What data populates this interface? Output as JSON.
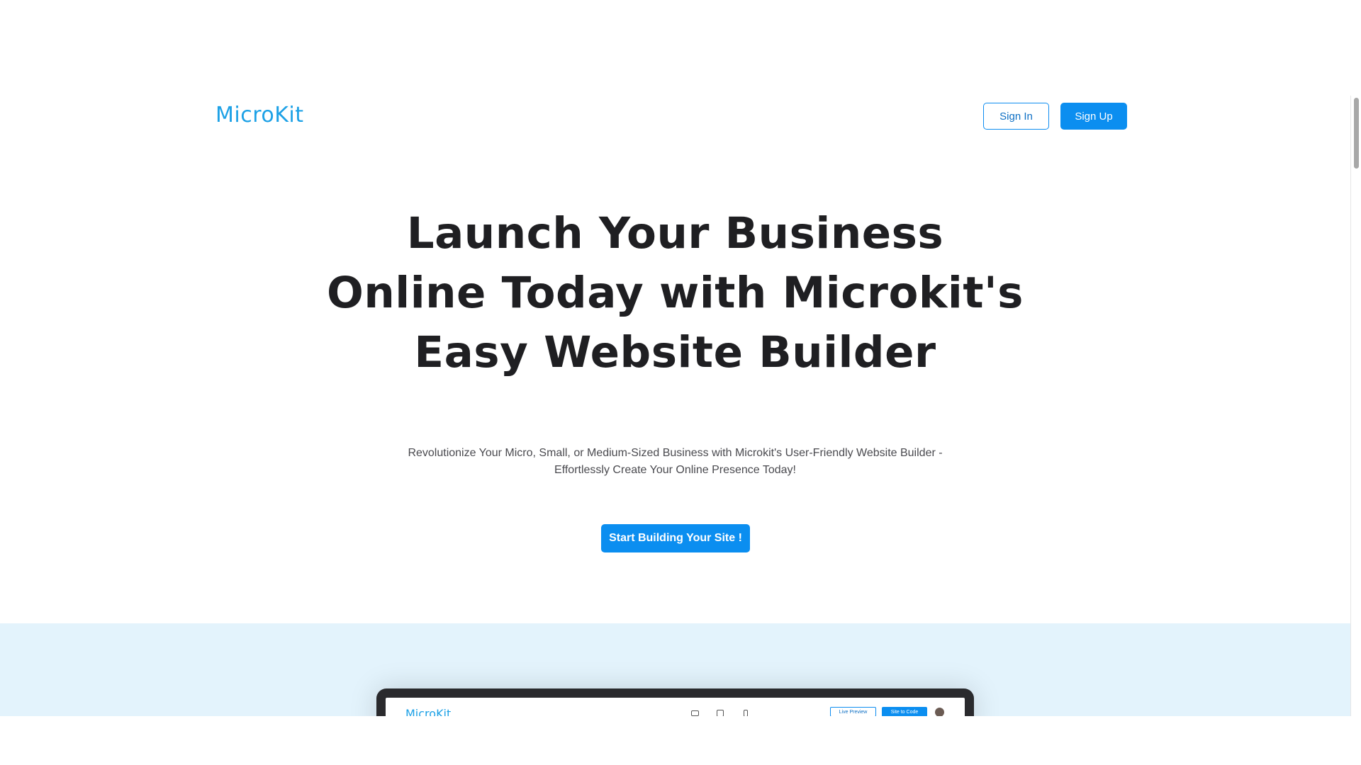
{
  "header": {
    "logo": "MicroKit",
    "sign_in_label": "Sign In",
    "sign_up_label": "Sign Up"
  },
  "hero": {
    "title": "Launch Your Business Online Today with Microkit's Easy Website Builder",
    "subtitle": "Revolutionize Your Micro, Small, or Medium-Sized Business with Microkit's User-Friendly Website Builder - Effortlessly Create Your Online Presence Today!",
    "cta_label": "Start Building Your Site !"
  },
  "showcase": {
    "preview": {
      "logo": "MicroKit",
      "device_icons": [
        "desktop-icon",
        "tablet-icon",
        "mobile-icon"
      ],
      "live_preview_label": "Live Preview",
      "site_to_code_label": "Site to Code"
    }
  },
  "colors": {
    "brand": "#1da1e6",
    "primary_button": "#0b8ef0",
    "heading": "#1f1f22",
    "showcase_background": "#e3f3fc"
  }
}
